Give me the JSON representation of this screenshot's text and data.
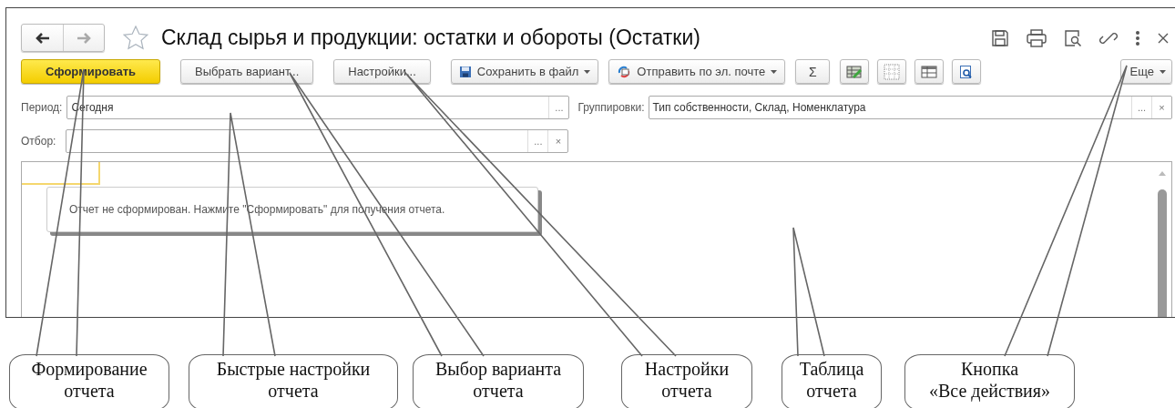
{
  "window": {
    "title": "Склад сырья и продукции: остатки и обороты (Остатки)",
    "back_disabled": false,
    "forward_disabled": true,
    "favorite": false
  },
  "toolbar": [
    {
      "kind": "primary",
      "label": "Сформировать"
    },
    {
      "kind": "button",
      "label": "Выбрать вариант..."
    },
    {
      "kind": "button",
      "label": "Настройки..."
    },
    {
      "kind": "dropdown",
      "label": "Сохранить в файл"
    },
    {
      "kind": "dropdown",
      "label": "Отправить по эл. почте"
    },
    {
      "kind": "symbol",
      "label": "Σ"
    },
    {
      "kind": "icon"
    },
    {
      "kind": "icon"
    },
    {
      "kind": "icon"
    },
    {
      "kind": "icon"
    },
    {
      "kind": "more",
      "label": "Еще"
    }
  ],
  "fields": [
    {
      "label": "Период:",
      "value": "Сегодня",
      "buttons": [
        "..."
      ]
    },
    {
      "label": "Группировки:",
      "value": "Тип собственности, Склад, Номенклатура",
      "buttons": [
        "...",
        "×"
      ]
    },
    {
      "label": "Отбор:",
      "buttons": [
        "...",
        "×"
      ]
    }
  ],
  "report": {
    "message": "Отчет не сформирован. Нажмите \"Сформировать\" для получения отчета."
  },
  "callouts": [
    {
      "lines": [
        "Формирование",
        "отчета"
      ]
    },
    {
      "lines": [
        "Быстрые настройки",
        "отчета"
      ]
    },
    {
      "lines": [
        "Выбор варианта",
        "отчета"
      ]
    },
    {
      "lines": [
        "Настройки",
        "отчета"
      ]
    },
    {
      "lines": [
        "Таблица",
        "отчета"
      ]
    },
    {
      "lines": [
        "Кнопка",
        "«Все действия»"
      ]
    }
  ]
}
